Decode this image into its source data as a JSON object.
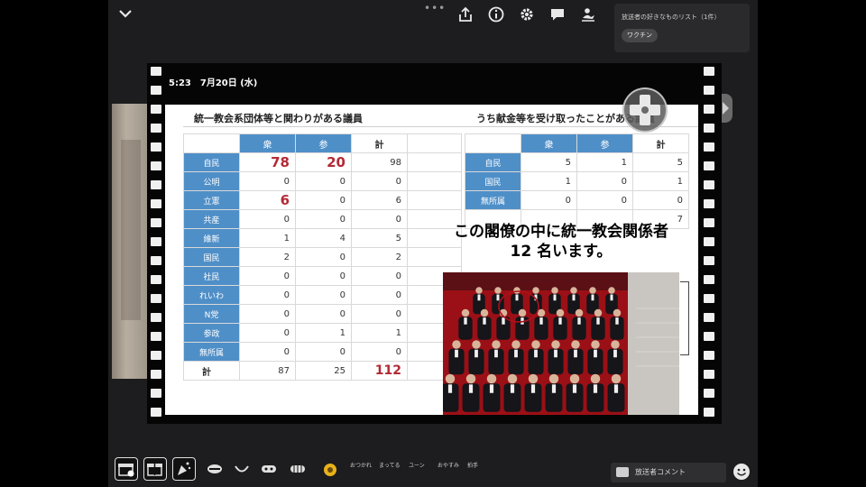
{
  "wishlist": {
    "title": "放送者の好きなものリスト（1件）",
    "chip": "ワクチン"
  },
  "top_icons": [
    "share-icon",
    "info-icon",
    "gear-icon",
    "chat-icon",
    "person-icon"
  ],
  "top_more": "•••",
  "slide": {
    "timestamp": "5:23　7月20日 (水)",
    "table1": {
      "title": "統一教会系団体等と関わりがある議員",
      "headers": [
        "衆",
        "参",
        "計"
      ],
      "rows": [
        {
          "party": "自民",
          "shu": "78",
          "san": "20",
          "kei": "98"
        },
        {
          "party": "公明",
          "shu": "0",
          "san": "0",
          "kei": "0"
        },
        {
          "party": "立憲",
          "shu": "6",
          "san": "0",
          "kei": "6"
        },
        {
          "party": "共産",
          "shu": "0",
          "san": "0",
          "kei": "0"
        },
        {
          "party": "維新",
          "shu": "1",
          "san": "4",
          "kei": "5"
        },
        {
          "party": "国民",
          "shu": "2",
          "san": "0",
          "kei": "2"
        },
        {
          "party": "社民",
          "shu": "0",
          "san": "0",
          "kei": "0"
        },
        {
          "party": "れいわ",
          "shu": "0",
          "san": "0",
          "kei": "0"
        },
        {
          "party": "N党",
          "shu": "0",
          "san": "0",
          "kei": "0"
        },
        {
          "party": "参政",
          "shu": "0",
          "san": "1",
          "kei": "1"
        },
        {
          "party": "無所属",
          "shu": "0",
          "san": "0",
          "kei": "0"
        }
      ],
      "total": {
        "label": "計",
        "shu": "87",
        "san": "25",
        "kei": "112"
      }
    },
    "table2": {
      "title": "うち献金等を受け取ったことがある議員",
      "headers": [
        "衆",
        "参",
        "計"
      ],
      "rows": [
        {
          "party": "自民",
          "shu": "5",
          "san": "1",
          "kei": "5"
        },
        {
          "party": "国民",
          "shu": "1",
          "san": "0",
          "kei": "1"
        },
        {
          "party": "無所属",
          "shu": "0",
          "san": "0",
          "kei": "0"
        }
      ],
      "total": {
        "kei": "7"
      }
    },
    "caption_line1": "この閣僚の中に統一教会関係者",
    "caption_line2": "12 名います。"
  },
  "bottom": {
    "stamps": [
      "おつかれ",
      "まってる",
      "ユーン",
      "おやすみ",
      "拍手"
    ],
    "comment_label": "放送者コメント"
  },
  "colors": {
    "party_blue": "#4f8fc8",
    "highlight_red": "#b22a35",
    "photo_red_carpet": "#9a1016"
  }
}
